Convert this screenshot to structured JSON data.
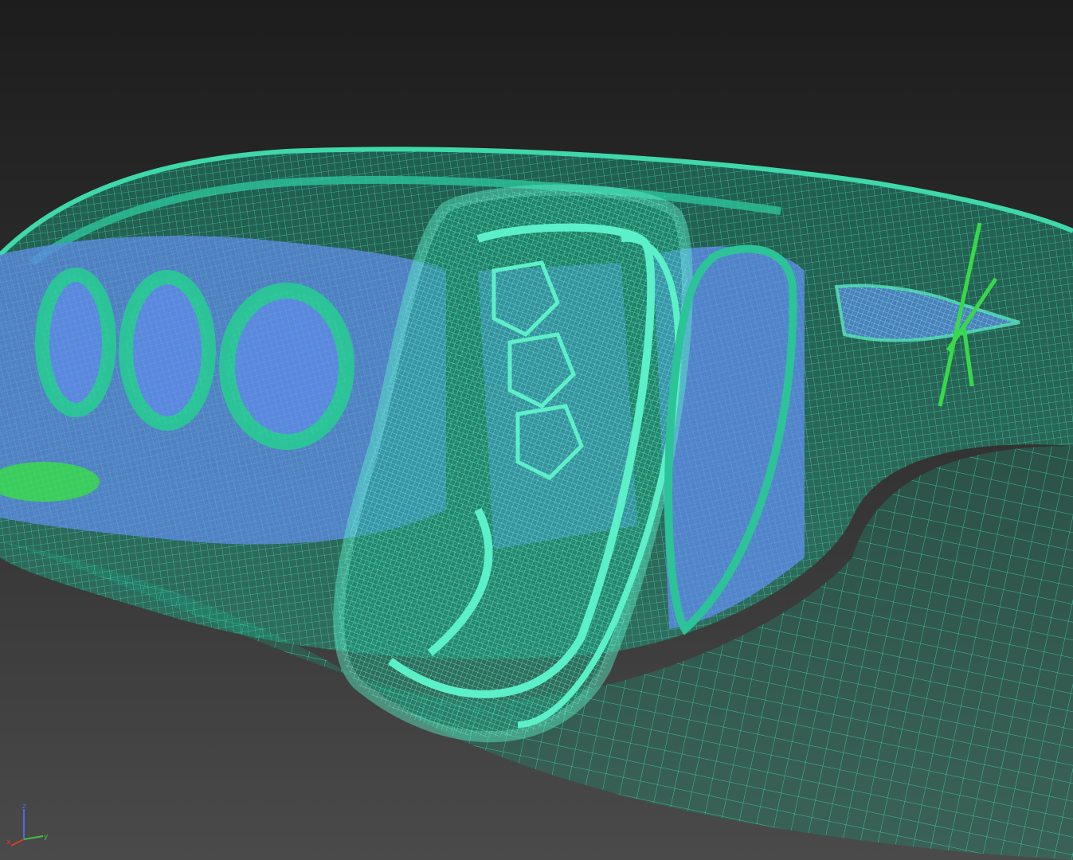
{
  "viewport": {
    "render_mode": "wireframe",
    "background_top": "#1d1d1d",
    "background_bottom": "#4a4a4a",
    "colors": {
      "body_wire": "#3fd8aa",
      "body_fill": "#1fa784",
      "ring_wire": "#5cf0c8",
      "interior_fill": "#5c86e0",
      "helper_green": "#38d948"
    }
  },
  "axis_gizmo": {
    "x_label": "x",
    "y_label": "y",
    "z_label": "z",
    "x_color": "#d0402a",
    "y_color": "#40c040",
    "z_color": "#4a6ae0"
  }
}
